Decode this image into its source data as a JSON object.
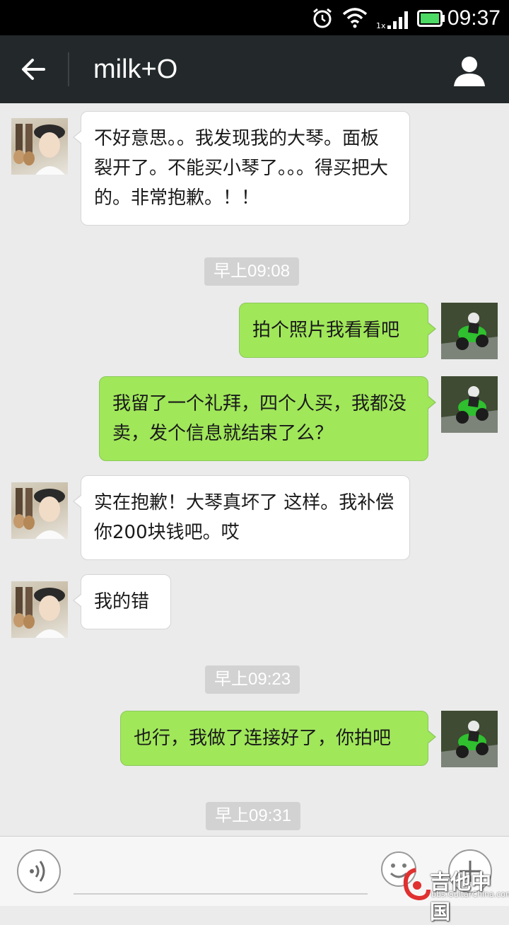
{
  "status_bar": {
    "time": "09:37",
    "signal_label": "1x",
    "icons": [
      "alarm-icon",
      "wifi-icon",
      "signal-icon",
      "battery-icon"
    ],
    "battery_color": "#4cd964"
  },
  "header": {
    "title": "milk+O",
    "back_icon": "back-arrow-icon",
    "profile_icon": "profile-icon"
  },
  "messages": [
    {
      "from": "friend",
      "text": "不好意思。。我发现我的大琴。面板裂开了。不能买小琴了。。。得买把大的。非常抱歉。！！"
    },
    {
      "type": "time",
      "text": "早上09:08"
    },
    {
      "from": "me",
      "text": "拍个照片我看看吧"
    },
    {
      "from": "me",
      "text": "我留了一个礼拜，四个人买，我都没卖，发个信息就结束了么？"
    },
    {
      "from": "friend",
      "text": "实在抱歉！大琴真坏了 这样。我补偿你200块钱吧。哎"
    },
    {
      "from": "friend",
      "text": "我的错"
    },
    {
      "type": "time",
      "text": "早上09:23"
    },
    {
      "from": "me",
      "text": "也行，我做了连接好了，你拍吧"
    },
    {
      "type": "time",
      "text": "早上09:31"
    }
  ],
  "input_bar": {
    "voice_icon": "voice-icon",
    "emoji_icon": "emoji-icon",
    "plus_icon": "plus-icon",
    "input_value": ""
  },
  "watermark": {
    "text": "吉他中国",
    "sub": "bbs.GuitarChina.com"
  },
  "colors": {
    "header_bg": "#23292b",
    "chat_bg": "#ebebeb",
    "outgoing_bubble": "#a0e75a",
    "incoming_bubble": "#ffffff"
  }
}
